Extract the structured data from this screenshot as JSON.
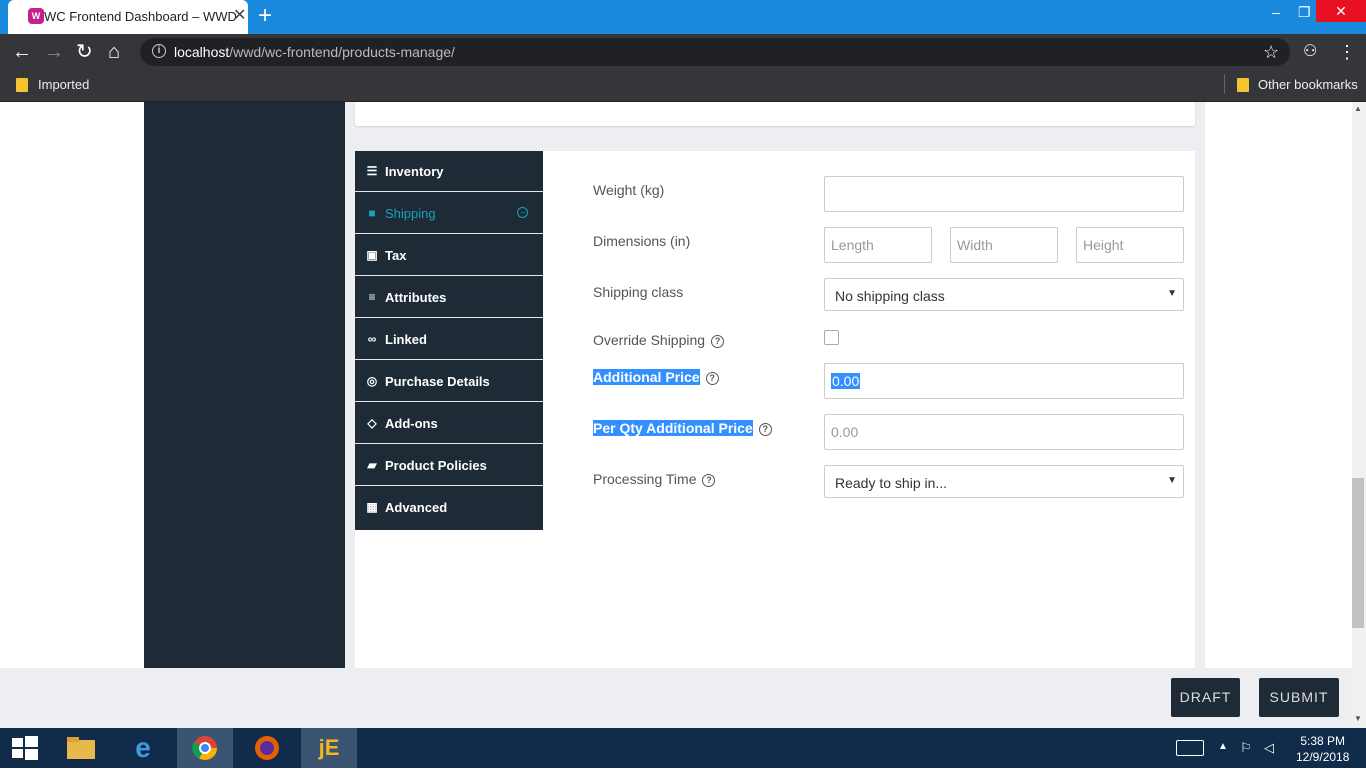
{
  "browser": {
    "tab_title": "WC Frontend Dashboard – WWD",
    "url_host": "localhost",
    "url_path": "/wwd/wc-frontend/products-manage/",
    "bookmarks": {
      "left": "Imported",
      "right": "Other bookmarks"
    }
  },
  "menu": {
    "items": [
      {
        "label": "Inventory",
        "icon": "database-icon"
      },
      {
        "label": "Shipping",
        "icon": "truck-icon"
      },
      {
        "label": "Tax",
        "icon": "money-icon"
      },
      {
        "label": "Attributes",
        "icon": "list-icon"
      },
      {
        "label": "Linked",
        "icon": "link-icon"
      },
      {
        "label": "Purchase Details",
        "icon": "target-icon"
      },
      {
        "label": "Add-ons",
        "icon": "diamond-icon"
      },
      {
        "label": "Product Policies",
        "icon": "ambulance-icon"
      },
      {
        "label": "Advanced",
        "icon": "grid-icon"
      }
    ],
    "active": "Shipping"
  },
  "form": {
    "weight_label": "Weight (kg)",
    "dimensions_label": "Dimensions (in)",
    "length_placeholder": "Length",
    "width_placeholder": "Width",
    "height_placeholder": "Height",
    "shipping_class_label": "Shipping class",
    "shipping_class_value": "No shipping class",
    "override_label": "Override Shipping",
    "additional_price_label": "Additional Price",
    "additional_price_value": "0.00",
    "per_qty_label": "Per Qty Additional Price",
    "per_qty_placeholder": "0.00",
    "processing_label": "Processing Time",
    "processing_value": "Ready to ship in..."
  },
  "footer": {
    "draft": "DRAFT",
    "submit": "SUBMIT"
  },
  "taskbar": {
    "time": "5:38 PM",
    "date": "12/9/2018"
  },
  "colors": {
    "sidebar": "#1e2b36",
    "accent": "#17a2b8",
    "chrome_blue": "#1a88dd",
    "selection": "#3390ff"
  }
}
